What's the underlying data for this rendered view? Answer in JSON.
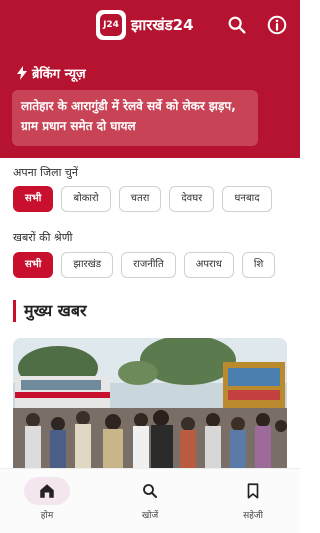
{
  "header": {
    "logo_text": "J24",
    "brand": "झारखंड24",
    "search_icon": "search-icon",
    "info_icon": "info-icon",
    "brand_color": "#b5132f"
  },
  "breaking": {
    "title": "ब्रेकिंग न्यूज़",
    "headline": "लातेहार के आरागुंडी में रेलवे सर्वे को लेकर झड़प, ग्राम प्रधान समेत दो घायल"
  },
  "district": {
    "label": "अपना जिला चुनें",
    "chips": [
      "सभी",
      "बोकारो",
      "चतरा",
      "देवघर",
      "धनबाद"
    ],
    "selected": "सभी"
  },
  "category": {
    "label": "खबरों की श्रेणी",
    "chips": [
      "सभी",
      "झारखंड",
      "राजनीति",
      "अपराध",
      "शि"
    ],
    "selected": "सभी"
  },
  "main": {
    "title": "मुख्य खबर"
  },
  "nav": {
    "items": [
      {
        "label": "होम",
        "icon": "home-icon"
      },
      {
        "label": "खोजें",
        "icon": "search-icon"
      },
      {
        "label": "सहेजी",
        "icon": "bookmark-icon"
      }
    ],
    "active": "होम"
  }
}
